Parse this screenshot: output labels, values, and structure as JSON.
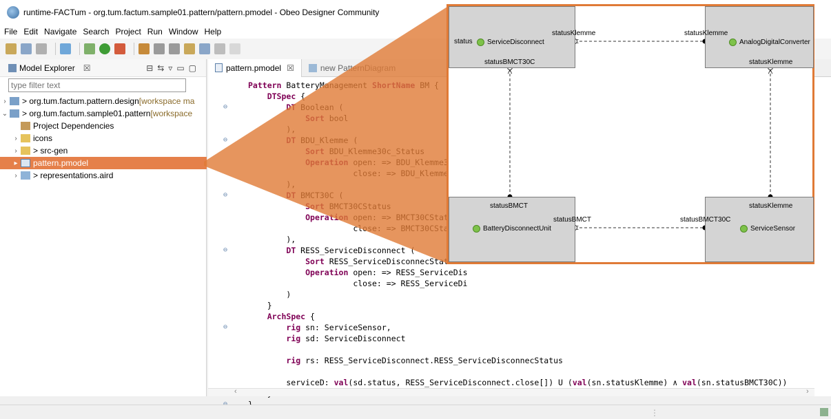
{
  "window": {
    "title": "runtime-FACTum - org.tum.factum.sample01.pattern/pattern.pmodel - Obeo Designer Community"
  },
  "menu": [
    "File",
    "Edit",
    "Navigate",
    "Search",
    "Project",
    "Run",
    "Window",
    "Help"
  ],
  "explorer": {
    "title": "Model Explorer",
    "close": "☒",
    "filter_placeholder": "type filter text",
    "items": [
      {
        "label": "> org.tum.factum.pattern.design",
        "decoration": " [workspace ma"
      },
      {
        "label": "> org.tum.factum.sample01.pattern",
        "decoration": " [workspace"
      },
      {
        "label": "Project Dependencies",
        "decoration": ""
      },
      {
        "label": "icons",
        "decoration": ""
      },
      {
        "label": "> src-gen",
        "decoration": ""
      },
      {
        "label": "pattern.pmodel",
        "decoration": ""
      },
      {
        "label": "> representations.aird",
        "decoration": ""
      }
    ]
  },
  "editor": {
    "tabs": [
      {
        "label": "pattern.pmodel",
        "close": "☒"
      },
      {
        "label": "new PatternDiagram",
        "close": ""
      }
    ],
    "code": [
      "Pattern BatteryManagement ShortName BM {",
      "    DTSpec {",
      "        DT Boolean (",
      "            Sort bool",
      "        ),",
      "        DT BDU_Klemme (",
      "            Sort BDU_Klemme30c_Status",
      "            Operation open: => BDU_Klemme30c_S",
      "                      close: => BDU_Klemme30c_",
      "        ),",
      "        DT BMCT30C (",
      "            Sort BMCT30CStatus",
      "            Operation open: => BMCT30CStatus,",
      "                      close: => BMCT30CStatus",
      "        ),",
      "        DT RESS_ServiceDisconnect (",
      "            Sort RESS_ServiceDisconnecStatus",
      "            Operation open: => RESS_ServiceDis",
      "                      close: => RESS_ServiceDi",
      "        )",
      "    }",
      "    ArchSpec {",
      "        rig sn: ServiceSensor,",
      "        rig sd: ServiceDisconnect",
      "",
      "        rig rs: RESS_ServiceDisconnect.RESS_ServiceDisconnecStatus",
      "",
      "        serviceD: val(sd.status, RESS_ServiceDisconnect.close[]) U (val(sn.statusKlemme) ∧ val(sn.statusBMCT30C))",
      "    }",
      "}"
    ]
  },
  "diagram": {
    "nodes": {
      "service_disconnect": "ServiceDisconnect",
      "adc": "AnalogDigitalConverter",
      "battery_unit": "BatteryDisconnectUnit",
      "service_sensor": "ServiceSensor"
    },
    "ports": {
      "sd_status": "status",
      "sd_klemme": "statusKlemme",
      "sd_bmct30c": "statusBMCT30C",
      "adc_klemme_top": "statusKlemme",
      "adc_klemme_bottom": "statusKlemme",
      "bdu_bmct_top": "statusBMCT",
      "bdu_bmct_right": "statusBMCT",
      "ss_bmct30c": "statusBMCT30C",
      "ss_klemme": "statusKlemme"
    }
  },
  "colors": {
    "highlight": "#e5804a",
    "frame": "#e07a36",
    "keyword": "#7f0055"
  }
}
